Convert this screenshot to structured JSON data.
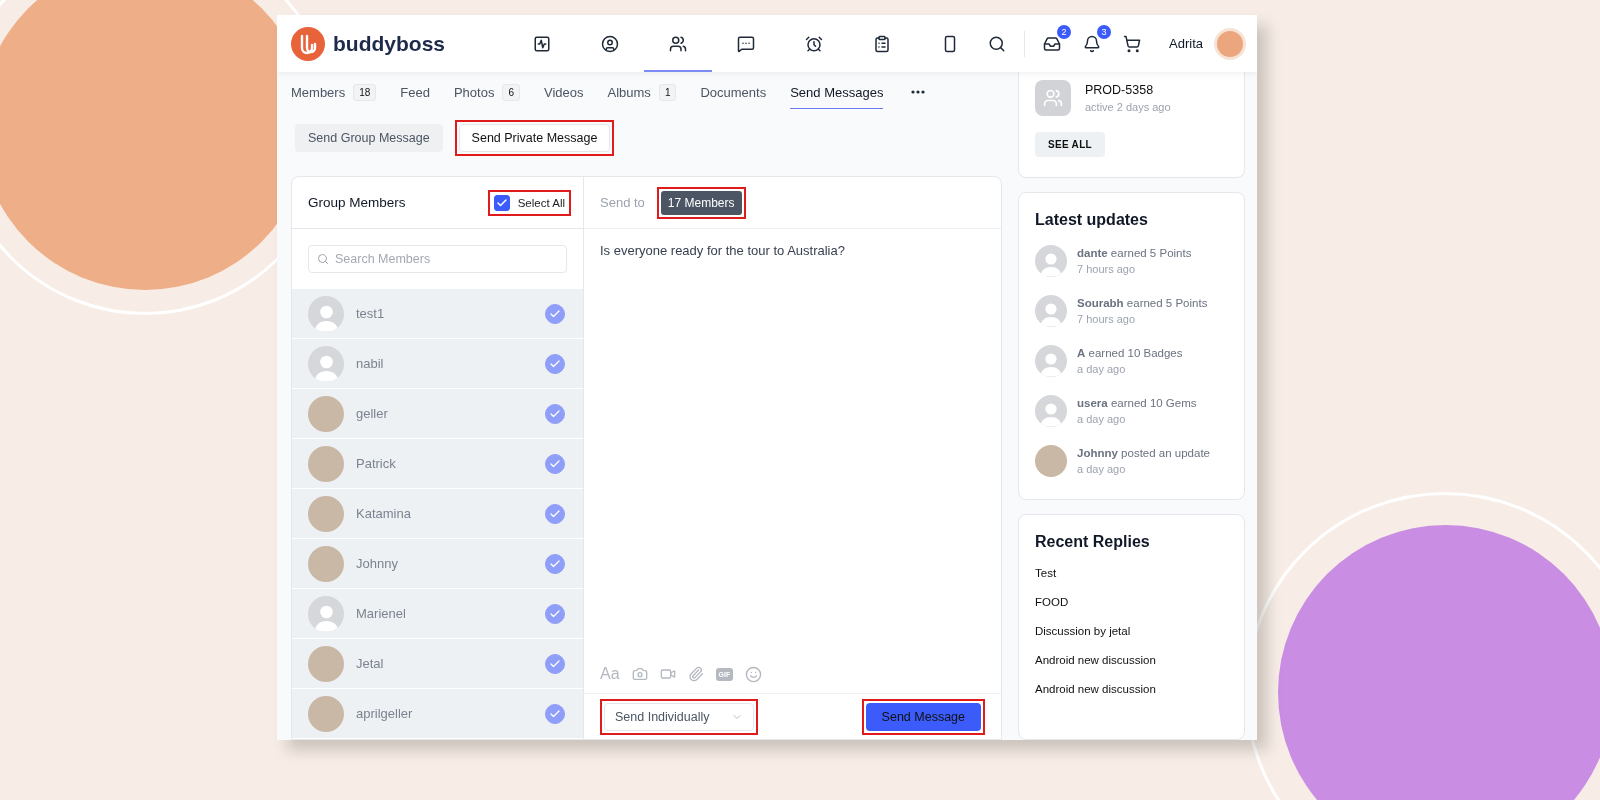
{
  "header": {
    "logo": "buddyboss",
    "nav": [
      {
        "selected": false
      },
      {
        "selected": false
      },
      {
        "selected": true
      },
      {
        "selected": false
      },
      {
        "selected": false
      },
      {
        "selected": false
      },
      {
        "selected": false
      }
    ],
    "inbox_badge": "2",
    "notifications_badge": "3",
    "user": {
      "name": "Adrita"
    }
  },
  "tabs": [
    {
      "label": "Members",
      "count": "18",
      "selected": false
    },
    {
      "label": "Feed",
      "selected": false
    },
    {
      "label": "Photos",
      "count": "6",
      "selected": false
    },
    {
      "label": "Videos",
      "selected": false
    },
    {
      "label": "Albums",
      "count": "1",
      "selected": false
    },
    {
      "label": "Documents",
      "selected": false
    },
    {
      "label": "Send Messages",
      "selected": true
    }
  ],
  "subtabs": [
    {
      "label": "Send Group Message",
      "selected": false,
      "highlighted": false
    },
    {
      "label": "Send Private Message",
      "selected": true,
      "highlighted": true
    }
  ],
  "group_members": {
    "title": "Group Members",
    "select_all": {
      "label": "Select All",
      "checked": true,
      "highlighted": true
    },
    "search": {
      "placeholder": "Search Members"
    },
    "members": [
      {
        "name": "test1",
        "avatar": {
          "kind": "placeholder"
        },
        "selected": true
      },
      {
        "name": "nabil",
        "avatar": {
          "kind": "placeholder"
        },
        "selected": true
      },
      {
        "name": "geller",
        "avatar": {
          "kind": "photo"
        },
        "selected": true
      },
      {
        "name": "Patrick",
        "avatar": {
          "kind": "photo"
        },
        "selected": true
      },
      {
        "name": "Katamina",
        "avatar": {
          "kind": "photo"
        },
        "selected": true
      },
      {
        "name": "Johnny",
        "avatar": {
          "kind": "photo"
        },
        "selected": true
      },
      {
        "name": "Marienel",
        "avatar": {
          "kind": "placeholder"
        },
        "selected": true
      },
      {
        "name": "Jetal",
        "avatar": {
          "kind": "photo"
        },
        "selected": true
      },
      {
        "name": "aprilgeller",
        "avatar": {
          "kind": "photo"
        },
        "selected": true
      }
    ]
  },
  "composer": {
    "send_to_label": "Send to",
    "recipients": {
      "label": "17 Members",
      "highlighted": true
    },
    "message": "Is everyone ready for the tour to Australia?",
    "toolbar": {
      "format": "Aa",
      "gif": "GIF"
    },
    "mode": {
      "value": "Send Individually",
      "highlighted": true
    },
    "send_button": {
      "label": "Send Message",
      "highlighted": true
    }
  },
  "sidebar": {
    "group": {
      "name": "PROD-5358",
      "status": "active 2 days ago",
      "button": "SEE ALL"
    },
    "latest_updates": {
      "title": "Latest updates",
      "items": [
        {
          "text": "**dante** earned 5 Points",
          "time": "7 hours ago",
          "avatar": {
            "kind": "placeholder"
          }
        },
        {
          "text": "**Sourabh** earned 5 Points",
          "time": "7 hours ago",
          "avatar": {
            "kind": "placeholder"
          }
        },
        {
          "text": "**A** earned 10 Badges",
          "time": "a day ago",
          "avatar": {
            "kind": "placeholder"
          }
        },
        {
          "text": "**usera** earned 10 Gems",
          "time": "a day ago",
          "avatar": {
            "kind": "placeholder"
          }
        },
        {
          "text": "**Johnny** posted an update",
          "time": "a day ago",
          "avatar": {
            "kind": "photo"
          }
        }
      ]
    },
    "recent_replies": {
      "title": "Recent Replies",
      "items": [
        "Test",
        "FOOD",
        "Discussion by jetal",
        "Android new discussion",
        "Android new discussion"
      ]
    }
  }
}
